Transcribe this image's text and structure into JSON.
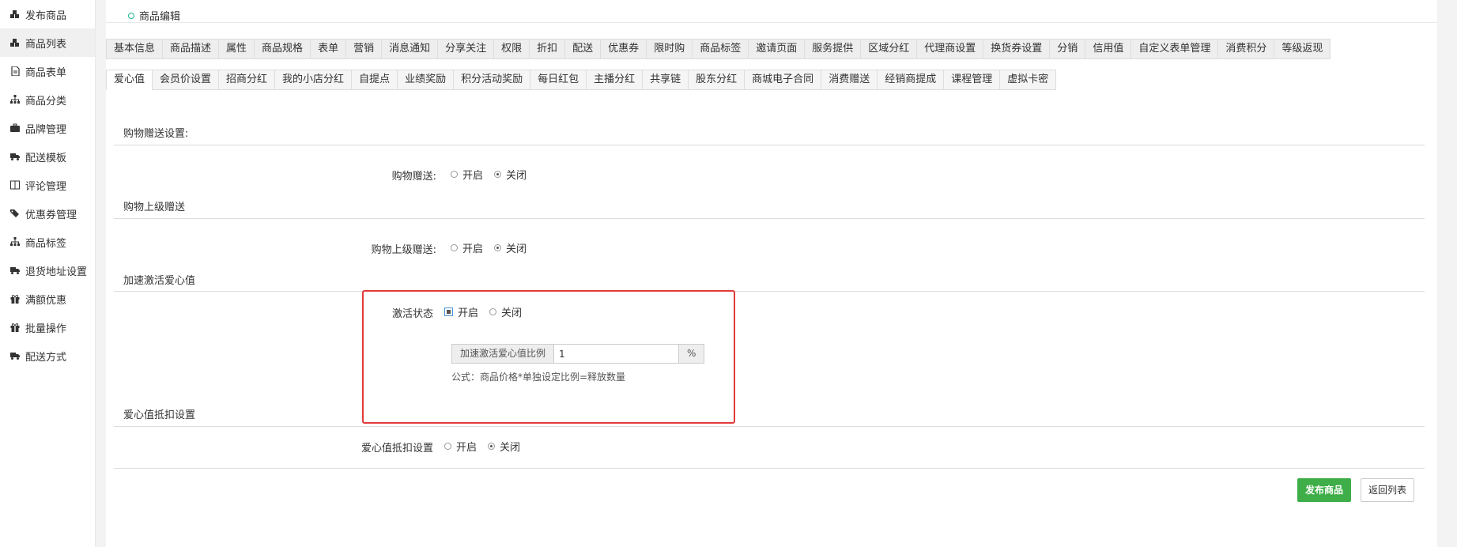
{
  "sidebar": {
    "items": [
      {
        "label": "发布商品",
        "icon": "cubes-icon"
      },
      {
        "label": "商品列表",
        "icon": "cubes-icon"
      },
      {
        "label": "商品表单",
        "icon": "file-icon"
      },
      {
        "label": "商品分类",
        "icon": "sitemap-icon"
      },
      {
        "label": "品牌管理",
        "icon": "briefcase-icon"
      },
      {
        "label": "配送模板",
        "icon": "truck-icon"
      },
      {
        "label": "评论管理",
        "icon": "columns-icon"
      },
      {
        "label": "优惠券管理",
        "icon": "tags-icon"
      },
      {
        "label": "商品标签",
        "icon": "sitemap-icon"
      },
      {
        "label": "退货地址设置",
        "icon": "truck-icon"
      },
      {
        "label": "满额优惠",
        "icon": "gift-icon"
      },
      {
        "label": "批量操作",
        "icon": "gift-icon"
      },
      {
        "label": "配送方式",
        "icon": "truck-icon"
      }
    ]
  },
  "breadcrumb": {
    "label": "商品编辑"
  },
  "tabs_row1": [
    "基本信息",
    "商品描述",
    "属性",
    "商品规格",
    "表单",
    "营销",
    "消息通知",
    "分享关注",
    "权限",
    "折扣",
    "配送",
    "优惠券",
    "限时购",
    "商品标签",
    "邀请页面",
    "服务提供",
    "区域分红",
    "代理商设置",
    "换货券设置",
    "分销",
    "信用值",
    "自定义表单管理",
    "消费积分",
    "等级返现"
  ],
  "tabs_row2": [
    "爱心值",
    "会员价设置",
    "招商分红",
    "我的小店分红",
    "自提点",
    "业绩奖励",
    "积分活动奖励",
    "每日红包",
    "主播分红",
    "共享链",
    "股东分红",
    "商城电子合同",
    "消费赠送",
    "经销商提成",
    "课程管理",
    "虚拟卡密"
  ],
  "sections": {
    "shopping_gift": {
      "title": "购物赠送设置:",
      "field_label": "购物赠送:",
      "opt_on": "开启",
      "opt_off": "关闭",
      "selected": "关闭"
    },
    "superior_gift": {
      "title": "购物上级赠送",
      "field_label": "购物上级赠送:",
      "opt_on": "开启",
      "opt_off": "关闭",
      "selected": "关闭"
    },
    "accelerate": {
      "title": "加速激活爱心值",
      "field_label": "激活状态",
      "opt_on": "开启",
      "opt_off": "关闭",
      "selected": "开启",
      "ratio_label": "加速激活爱心值比例",
      "ratio_value": "1",
      "ratio_unit": "%",
      "formula": "公式：商品价格*单独设定比例=释放数量"
    },
    "deduct": {
      "title": "爱心值抵扣设置",
      "field_label": "爱心值抵扣设置",
      "opt_on": "开启",
      "opt_off": "关闭",
      "selected": "关闭"
    }
  },
  "buttons": {
    "publish": "发布商品",
    "back": "返回列表"
  },
  "colors": {
    "primary": "#3fae49",
    "highlight": "#e23a3a"
  }
}
